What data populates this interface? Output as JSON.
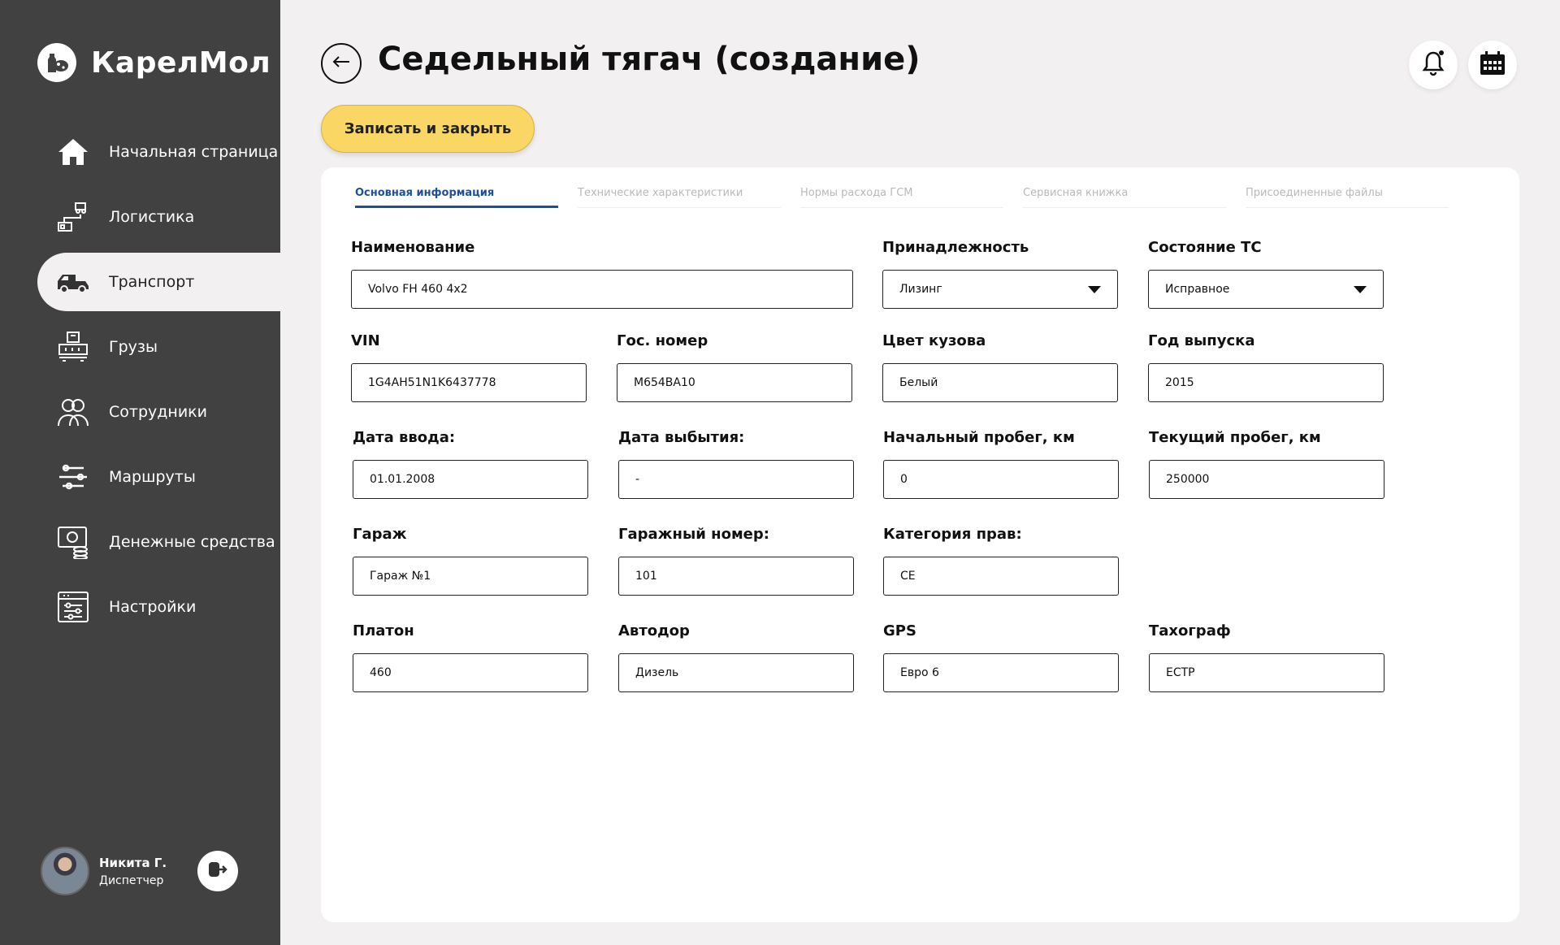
{
  "app": {
    "name": "КарелМол"
  },
  "sidebar": {
    "items": [
      {
        "label": "Начальная страница",
        "icon": "home-icon"
      },
      {
        "label": "Логистика",
        "icon": "logistics-icon"
      },
      {
        "label": "Транспорт",
        "icon": "truck-icon",
        "active": true
      },
      {
        "label": "Грузы",
        "icon": "cargo-icon"
      },
      {
        "label": "Сотрудники",
        "icon": "employees-icon"
      },
      {
        "label": "Маршруты",
        "icon": "routes-icon"
      },
      {
        "label": "Денежные средства",
        "icon": "money-icon"
      },
      {
        "label": "Настройки",
        "icon": "settings-icon"
      }
    ],
    "user": {
      "name": "Никита Г.",
      "role": "Диспетчер"
    }
  },
  "header": {
    "title": "Седельный тягач (создание)",
    "save_label": "Записать и закрыть"
  },
  "tabs": [
    {
      "label": "Основная информация",
      "active": true
    },
    {
      "label": "Технические характеристики"
    },
    {
      "label": "Нормы расхода ГСМ"
    },
    {
      "label": "Сервисная книжка"
    },
    {
      "label": "Присоединенные файлы"
    }
  ],
  "form": {
    "name": {
      "label": "Наименование",
      "value": "Volvo FH 460 4x2"
    },
    "ownership": {
      "label": "Принадлежность",
      "value": "Лизинг"
    },
    "condition": {
      "label": "Состояние ТС",
      "value": "Исправное"
    },
    "vin": {
      "label": "VIN",
      "value": "1G4AH51N1K6437778"
    },
    "plate": {
      "label": "Гос. номер",
      "value": "М654ВА10"
    },
    "color": {
      "label": "Цвет кузова",
      "value": "Белый"
    },
    "year": {
      "label": "Год выпуска",
      "value": "2015"
    },
    "entry_date": {
      "label": "Дата ввода:",
      "value": "01.01.2008"
    },
    "exit_date": {
      "label": "Дата выбытия:",
      "value": "-"
    },
    "start_mileage": {
      "label": "Начальный пробег, км",
      "value": "0"
    },
    "current_mileage": {
      "label": "Текущий пробег, км",
      "value": "250000"
    },
    "garage": {
      "label": "Гараж",
      "value": "Гараж №1"
    },
    "garage_number": {
      "label": "Гаражный номер:",
      "value": "101"
    },
    "license_category": {
      "label": "Категория прав:",
      "value": "CE"
    },
    "platon": {
      "label": "Платон",
      "value": "460"
    },
    "avtodor": {
      "label": "Автодор",
      "value": "Дизель"
    },
    "gps": {
      "label": "GPS",
      "value": "Евро 6"
    },
    "tachograph": {
      "label": "Тахограф",
      "value": "ЕСТР"
    }
  },
  "colors": {
    "sidebar": "#414141",
    "accent": "#fad664",
    "tab_active": "#1e4f9a",
    "background": "#f3f0f2"
  }
}
